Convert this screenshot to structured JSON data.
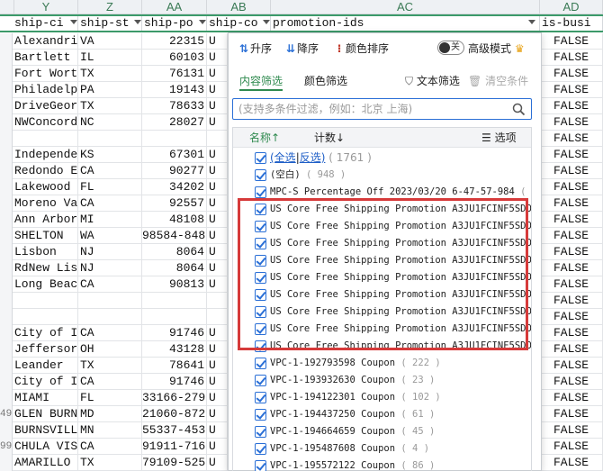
{
  "sheet": {
    "columns": [
      {
        "letter": "Y",
        "header": "ship-ci"
      },
      {
        "letter": "Z",
        "header": "ship-st"
      },
      {
        "letter": "AA",
        "header": "ship-po"
      },
      {
        "letter": "AB",
        "header": "ship-co"
      },
      {
        "letter": "AC",
        "header": "promotion-ids"
      },
      {
        "letter": "AD",
        "header": "is-busi"
      }
    ],
    "rows": [
      {
        "rn": "",
        "city": "Alexandri",
        "state": "VA",
        "postal": "22315",
        "country": "U",
        "busi": "FALSE"
      },
      {
        "rn": "",
        "city": "Bartlett",
        "state": "IL",
        "postal": "60103",
        "country": "U",
        "busi": "FALSE"
      },
      {
        "rn": "",
        "city": "Fort Wort",
        "state": "TX",
        "postal": "76131",
        "country": "U",
        "busi": "FALSE"
      },
      {
        "rn": "",
        "city": "Philadelp",
        "state": "PA",
        "postal": "19143",
        "country": "U",
        "busi": "FALSE"
      },
      {
        "rn": "",
        "city": "DriveGeor",
        "state": "TX",
        "postal": "78633",
        "country": "U",
        "busi": "FALSE"
      },
      {
        "rn": "",
        "city": "NWConcord",
        "state": "NC",
        "postal": "28027",
        "country": "U",
        "busi": "FALSE"
      },
      {
        "rn": "",
        "city": "",
        "state": "",
        "postal": "",
        "country": "",
        "busi": "FALSE"
      },
      {
        "rn": "",
        "city": "Independe",
        "state": "KS",
        "postal": "67301",
        "country": "U",
        "busi": "FALSE"
      },
      {
        "rn": "",
        "city": "Redondo E",
        "state": "CA",
        "postal": "90277",
        "country": "U",
        "busi": "FALSE"
      },
      {
        "rn": "",
        "city": "Lakewood",
        "state": "FL",
        "postal": "34202",
        "country": "U",
        "busi": "FALSE"
      },
      {
        "rn": "",
        "city": "Moreno Va",
        "state": "CA",
        "postal": "92557",
        "country": "U",
        "busi": "FALSE"
      },
      {
        "rn": "",
        "city": "Ann Arbor",
        "state": "MI",
        "postal": "48108",
        "country": "U",
        "busi": "FALSE"
      },
      {
        "rn": "",
        "city": "SHELTON",
        "state": "WA",
        "postal": "98584-848",
        "country": "U",
        "busi": "FALSE"
      },
      {
        "rn": "",
        "city": "Lisbon",
        "state": "NJ",
        "postal": "8064",
        "country": "U",
        "busi": "FALSE"
      },
      {
        "rn": "",
        "city": "RdNew Lis",
        "state": "NJ",
        "postal": "8064",
        "country": "U",
        "busi": "FALSE"
      },
      {
        "rn": "",
        "city": "Long Beac",
        "state": "CA",
        "postal": "90813",
        "country": "U",
        "busi": "FALSE"
      },
      {
        "rn": "",
        "city": "",
        "state": "",
        "postal": "",
        "country": "",
        "busi": "FALSE"
      },
      {
        "rn": "",
        "city": "",
        "state": "",
        "postal": "",
        "country": "",
        "busi": "FALSE"
      },
      {
        "rn": "",
        "city": "City of I",
        "state": "CA",
        "postal": "91746",
        "country": "U",
        "busi": "FALSE"
      },
      {
        "rn": "",
        "city": "Jeffersor",
        "state": "OH",
        "postal": "43128",
        "country": "U",
        "busi": "FALSE"
      },
      {
        "rn": "",
        "city": "Leander",
        "state": "TX",
        "postal": "78641",
        "country": "U",
        "busi": "FALSE"
      },
      {
        "rn": "",
        "city": "City of I",
        "state": "CA",
        "postal": "91746",
        "country": "U",
        "busi": "FALSE"
      },
      {
        "rn": "",
        "city": "MIAMI",
        "state": "FL",
        "postal": "33166-279",
        "country": "U",
        "busi": "FALSE"
      },
      {
        "rn": "49",
        "city": "GLEN BURN",
        "state": "MD",
        "postal": "21060-872",
        "country": "U",
        "busi": "FALSE"
      },
      {
        "rn": "",
        "city": "BURNSVILL",
        "state": "MN",
        "postal": "55337-453",
        "country": "U",
        "busi": "FALSE"
      },
      {
        "rn": "99",
        "city": "CHULA VIS",
        "state": "CA",
        "postal": "91911-716",
        "country": "U",
        "busi": "FALSE"
      },
      {
        "rn": "",
        "city": "AMARILLO",
        "state": "TX",
        "postal": "79109-525",
        "country": "U",
        "busi": "FALSE"
      }
    ]
  },
  "panel": {
    "sort_asc": "升序",
    "sort_desc": "降序",
    "sort_color": "颜色排序",
    "toggle_state": "关",
    "advanced_mode": "高级模式",
    "tab_content": "内容筛选",
    "tab_color": "颜色筛选",
    "text_filter": "文本筛选",
    "clear_conditions": "清空条件",
    "search_placeholder": "(支持多条件过滤，例如：北京 上海)",
    "list_header_name": "名称↑",
    "list_header_count": "计数↓",
    "list_header_options": "选项",
    "select_all": "(全选",
    "invert": "反选)",
    "select_all_count": "( 1761 )",
    "items": [
      {
        "text": "(空白)",
        "count": "( 948 )"
      },
      {
        "text": "MPC-S Percentage Off 2023/03/20 6-47-57-984",
        "count": "( 7"
      },
      {
        "text": "US Core Free Shipping Promotion A3JU1FCINF5SDO",
        "count": ""
      },
      {
        "text": "US Core Free Shipping Promotion A3JU1FCINF5SDO,V",
        "count": ""
      },
      {
        "text": "US Core Free Shipping Promotion A3JU1FCINF5SDO,V",
        "count": ""
      },
      {
        "text": "US Core Free Shipping Promotion A3JU1FCINF5SDO,V",
        "count": ""
      },
      {
        "text": "US Core Free Shipping Promotion A3JU1FCINF5SDO,V",
        "count": ""
      },
      {
        "text": "US Core Free Shipping Promotion A3JU1FCINF5SDO,V",
        "count": ""
      },
      {
        "text": "US Core Free Shipping Promotion A3JU1FCINF5SDO,翌",
        "count": ""
      },
      {
        "text": "US Core Free Shipping Promotion A3JU1FCINF5SDO,粮",
        "count": ""
      },
      {
        "text": "US Core Free Shipping Promotion A3JU1FCINF5SDO,贝",
        "count": ""
      },
      {
        "text": "VPC-1-192793598 Coupon",
        "count": "( 222 )"
      },
      {
        "text": "VPC-1-193932630 Coupon",
        "count": "( 23 )"
      },
      {
        "text": "VPC-1-194122301 Coupon",
        "count": "( 102 )"
      },
      {
        "text": "VPC-1-194437250 Coupon",
        "count": "( 61 )"
      },
      {
        "text": "VPC-1-194664659 Coupon",
        "count": "( 45 )"
      },
      {
        "text": "VPC-1-195487608 Coupon",
        "count": "( 4 )"
      },
      {
        "text": "VPC-1-195572122 Coupon",
        "count": "( 86 )"
      }
    ]
  }
}
